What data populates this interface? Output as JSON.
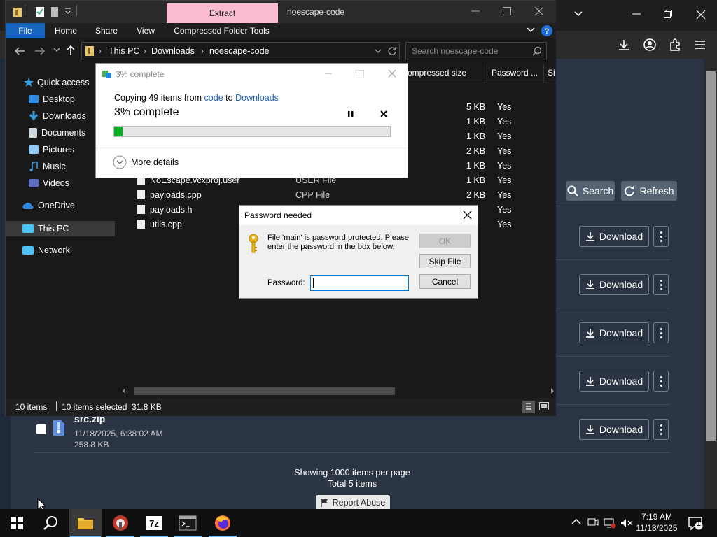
{
  "browser": {
    "search_label": "Search",
    "refresh_label": "Refresh",
    "download_label": "Download",
    "file_item": {
      "name": "src.zip",
      "date": "11/18/2025, 6:38:02 AM",
      "size": "258.8 KB"
    },
    "pagination": {
      "per_page": "Showing 1000 items per page",
      "total": "Total 5 items"
    },
    "report_label": "Report Abuse"
  },
  "explorer": {
    "title": "noescape-code",
    "context_tab": "Extract",
    "ribbon": {
      "file": "File",
      "home": "Home",
      "share": "Share",
      "view": "View",
      "tools": "Compressed Folder Tools"
    },
    "breadcrumb": [
      "This PC",
      "Downloads",
      "noescape-code"
    ],
    "search_placeholder": "Search noescape-code",
    "columns": {
      "compressed_size": "ompressed size",
      "password": "Password ...",
      "size_cut": "Si"
    },
    "nav": {
      "quick_access": "Quick access",
      "desktop": "Desktop",
      "downloads": "Downloads",
      "documents": "Documents",
      "pictures": "Pictures",
      "music": "Music",
      "videos": "Videos",
      "onedrive": "OneDrive",
      "this_pc": "This PC",
      "network": "Network"
    },
    "hidden_rows": [
      {
        "size": "5 KB",
        "pw": "Yes"
      },
      {
        "size": "1 KB",
        "pw": "Yes"
      },
      {
        "size": "1 KB",
        "pw": "Yes"
      },
      {
        "size": "2 KB",
        "pw": "Yes"
      },
      {
        "size": "1 KB",
        "pw": "Yes"
      }
    ],
    "rows": [
      {
        "name": "NoEscape.vcxproj.user",
        "type": "USER File",
        "size": "1 KB",
        "pw": "Yes"
      },
      {
        "name": "payloads.cpp",
        "type": "CPP File",
        "size": "2 KB",
        "pw": "Yes"
      },
      {
        "name": "payloads.h",
        "type": "",
        "size": "",
        "pw": "Yes"
      },
      {
        "name": "utils.cpp",
        "type": "",
        "size": "",
        "pw": "Yes"
      }
    ],
    "status": {
      "items": "10 items",
      "selected": "10 items selected  31.8 KB"
    }
  },
  "copy_dialog": {
    "title": "3% complete",
    "copying_prefix": "Copying 49 items from",
    "from": "code",
    "to_word": "to",
    "dest": "Downloads",
    "progress_text": "3% complete",
    "progress": 0.03,
    "more_details": "More details"
  },
  "password_dialog": {
    "title": "Password needed",
    "message": "File 'main' is password protected.  Please enter the password in the box below.",
    "password_label": "Password:",
    "password_value": "",
    "ok": "OK",
    "skip": "Skip File",
    "cancel": "Cancel"
  },
  "taskbar": {
    "time": "7:19 AM",
    "date": "11/18/2025",
    "notification_count": "1"
  }
}
